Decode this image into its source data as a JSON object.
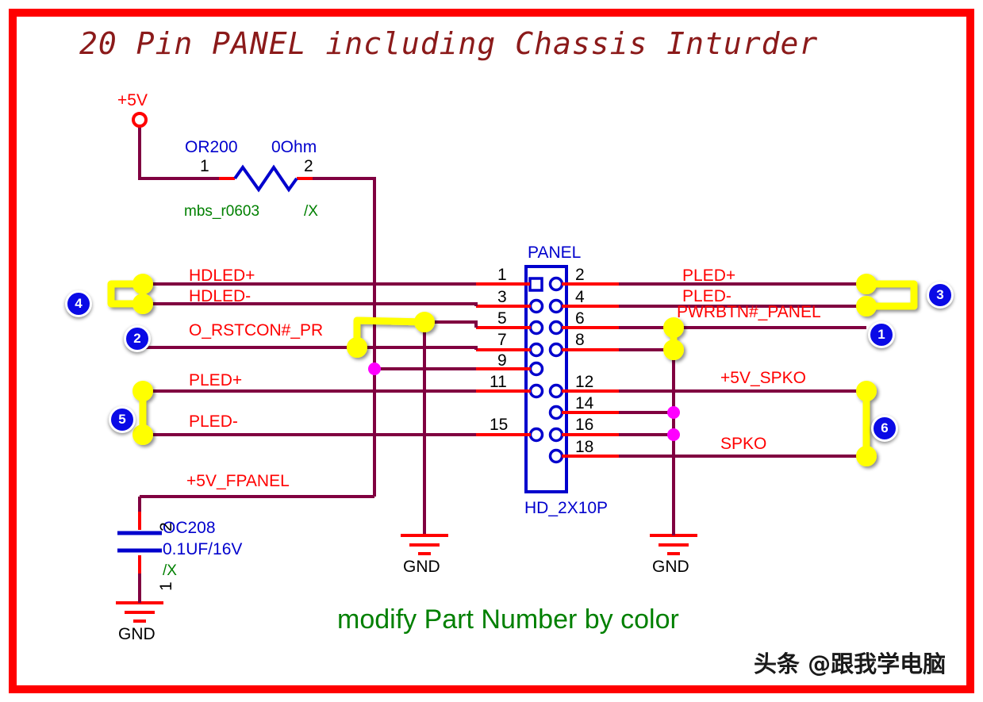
{
  "sheet": {
    "title": "20 Pin PANEL including Chassis Inturder",
    "note": "modify Part Number by color",
    "watermark": "头条 @跟我学电脑",
    "border_color": "#ff0000",
    "wire_color": "#800040",
    "pin_stub_color": "#ff0000",
    "symbol_color": "#0000cd",
    "net_label_color": "#ff0000",
    "highlight_color": "#ffff00",
    "junction_color": "#ff00ff",
    "badge_color": "#0a0ae6"
  },
  "power": {
    "rail_label": "+5V"
  },
  "resistor": {
    "designator": "OR200",
    "value": "0Ohm",
    "footprint": "mbs_r0603",
    "variant": "/X",
    "pin1": "1",
    "pin2": "2"
  },
  "capacitor": {
    "designator": "OC208",
    "value": "0.1UF/16V",
    "variant": "/X",
    "pin1": "1",
    "pin2": "2"
  },
  "connector": {
    "designator": "PANEL",
    "footprint": "HD_2X10P",
    "left_pins": [
      "1",
      "3",
      "5",
      "7",
      "9",
      "11",
      "15"
    ],
    "right_pins": [
      "2",
      "4",
      "6",
      "8",
      "12",
      "14",
      "16",
      "18"
    ]
  },
  "nets": {
    "left": [
      {
        "label": "HDLED+",
        "pin": "1"
      },
      {
        "label": "HDLED-",
        "pin": "3"
      },
      {
        "label": "O_RSTCON#_PR",
        "pin": "7"
      },
      {
        "label": "PLED+",
        "pin": "11"
      },
      {
        "label": "PLED-",
        "pin": "15"
      },
      {
        "label": "+5V_FPANEL",
        "pin": ""
      }
    ],
    "right": [
      {
        "label": "PLED+",
        "pin": "2"
      },
      {
        "label": "PLED-",
        "pin": "4"
      },
      {
        "label": "PWRBTN#_PANEL",
        "pin": "6"
      },
      {
        "label": "+5V_SPKO",
        "pin": "12"
      },
      {
        "label": "SPKO",
        "pin": "18"
      }
    ]
  },
  "grounds": [
    {
      "label": "GND"
    },
    {
      "label": "GND"
    },
    {
      "label": "GND"
    }
  ],
  "badges": [
    {
      "number": "4"
    },
    {
      "number": "2"
    },
    {
      "number": "5"
    },
    {
      "number": "3"
    },
    {
      "number": "1"
    },
    {
      "number": "6"
    }
  ]
}
